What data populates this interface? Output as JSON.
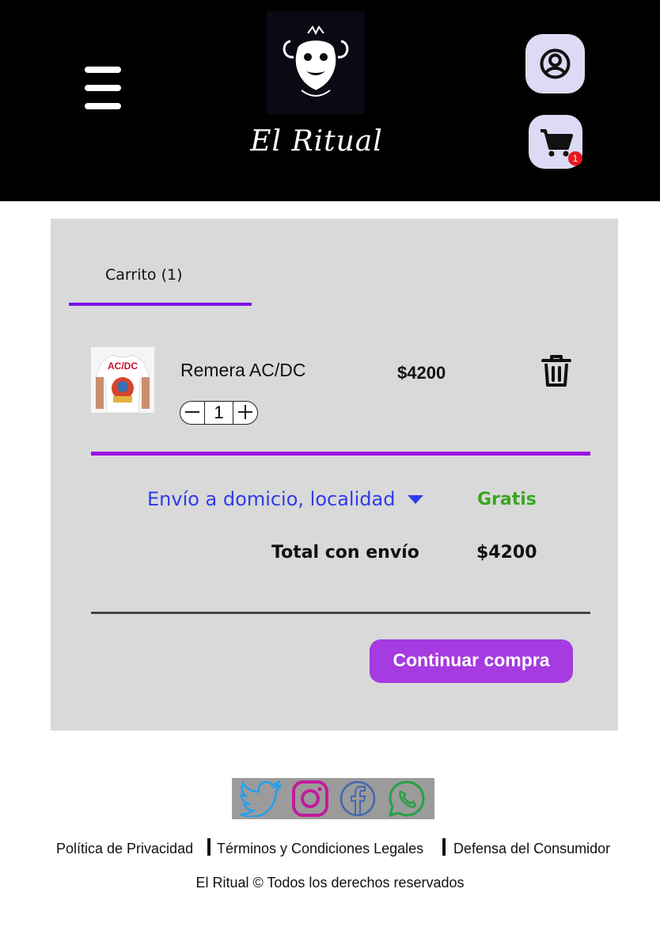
{
  "header": {
    "brand": "El Ritual",
    "cart_count": "1"
  },
  "cart": {
    "tab_label": "Carrito (1)",
    "items": [
      {
        "name": "Remera AC/DC",
        "quantity": "1",
        "price": "$4200",
        "image_text": "AC/DC"
      }
    ],
    "shipping_option": "Envío a domicio, localidad",
    "shipping_cost": "Gratis",
    "total_label": "Total con envío",
    "total_value": "$4200",
    "continue_label": "Continuar compra"
  },
  "colors": {
    "accent_purple": "#9914e0",
    "button_purple": "#a53be0",
    "shipping_blue": "#2f3bea",
    "free_green": "#3aa61f",
    "icon_bg": "#dcdaf4"
  },
  "footer": {
    "social_icons": [
      "twitter-icon",
      "instagram-icon",
      "facebook-icon",
      "whatsapp-icon"
    ],
    "links": [
      "Política de Privacidad",
      "Términos y Condiciones Legales",
      "Defensa del Consumidor"
    ],
    "copyright": "El Ritual © Todos los derechos reservados"
  }
}
